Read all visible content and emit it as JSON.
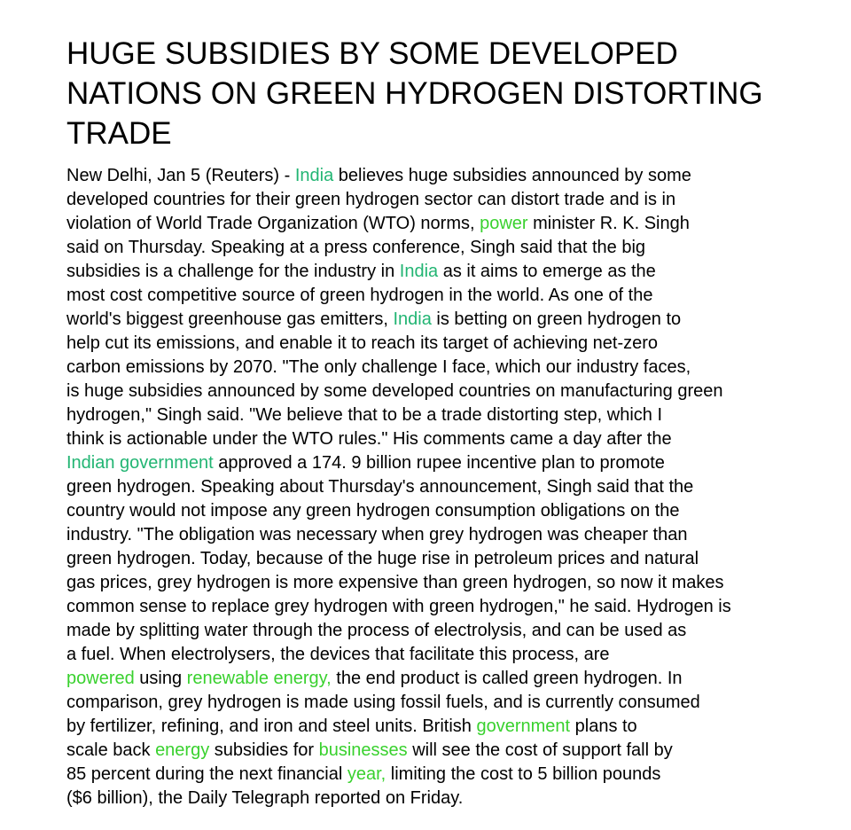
{
  "article": {
    "headline_lines": [
      "HUGE SUBSIDIES BY SOME DEVELOPED",
      "NATIONS ON GREEN HYDROGEN DISTORTING",
      "TRADE"
    ],
    "colors": {
      "text": "#000000",
      "keyword_teal": "#22b573",
      "keyword_green": "#39d12e"
    },
    "lines": [
      [
        {
          "t": "New Delhi, Jan 5 (Reuters) - "
        },
        {
          "t": "India",
          "c": "teal"
        },
        {
          "t": " believes huge subsidies announced by some"
        }
      ],
      [
        {
          "t": "developed countries for their green hydrogen sector can distort trade and is in"
        }
      ],
      [
        {
          "t": "violation of World Trade Organization (WTO) norms, "
        },
        {
          "t": "power",
          "c": "green"
        },
        {
          "t": " minister R. K. Singh"
        }
      ],
      [
        {
          "t": "said on Thursday. Speaking at a press conference, Singh said that the big"
        }
      ],
      [
        {
          "t": "subsidies is a challenge for the industry in "
        },
        {
          "t": "India",
          "c": "teal"
        },
        {
          "t": " as it aims to emerge as the"
        }
      ],
      [
        {
          "t": "most cost competitive source of green hydrogen in the world. As one of the"
        }
      ],
      [
        {
          "t": "world's biggest greenhouse gas emitters, "
        },
        {
          "t": "India",
          "c": "teal"
        },
        {
          "t": " is betting on green hydrogen to"
        }
      ],
      [
        {
          "t": "help cut its emissions, and enable it to reach its target of achieving net-zero"
        }
      ],
      [
        {
          "t": "carbon emissions by 2070. \"The only challenge I face, which our industry faces,"
        }
      ],
      [
        {
          "t": "is huge subsidies announced by some developed countries on manufacturing green"
        }
      ],
      [
        {
          "t": "hydrogen,\" Singh said. \"We believe that to be a trade distorting step, which I"
        }
      ],
      [
        {
          "t": "think is actionable under the WTO rules.\" His comments came a day after the"
        }
      ],
      [
        {
          "t": "Indian government",
          "c": "teal"
        },
        {
          "t": " approved a 174. 9 billion rupee incentive plan to promote"
        }
      ],
      [
        {
          "t": "green hydrogen. Speaking about Thursday's announcement, Singh said that the"
        }
      ],
      [
        {
          "t": "country would not impose any green hydrogen consumption obligations on the"
        }
      ],
      [
        {
          "t": "industry. \"The obligation was necessary when grey hydrogen was cheaper than"
        }
      ],
      [
        {
          "t": "green hydrogen. Today, because of the huge rise in petroleum prices and natural"
        }
      ],
      [
        {
          "t": "gas prices, grey hydrogen is more expensive than green hydrogen, so now it makes"
        }
      ],
      [
        {
          "t": "common sense to replace grey hydrogen with green hydrogen,\" he said. Hydrogen is"
        }
      ],
      [
        {
          "t": "made by splitting water through the process of electrolysis, and can be used as"
        }
      ],
      [
        {
          "t": "a fuel. When electrolysers, the devices that facilitate this process, are"
        }
      ],
      [
        {
          "t": "powered",
          "c": "green"
        },
        {
          "t": " using "
        },
        {
          "t": "renewable energy,",
          "c": "green"
        },
        {
          "t": " the end product is called green hydrogen. In"
        }
      ],
      [
        {
          "t": "comparison, grey hydrogen is made using fossil fuels, and is currently consumed"
        }
      ],
      [
        {
          "t": "by fertilizer, refining, and iron and steel units. British "
        },
        {
          "t": "government",
          "c": "green"
        },
        {
          "t": " plans to"
        }
      ],
      [
        {
          "t": "scale back "
        },
        {
          "t": "energy",
          "c": "green"
        },
        {
          "t": " subsidies for "
        },
        {
          "t": "businesses",
          "c": "green"
        },
        {
          "t": " will see the cost of support fall by"
        }
      ],
      [
        {
          "t": "85 percent during the next financial "
        },
        {
          "t": "year,",
          "c": "green"
        },
        {
          "t": " limiting the cost to 5 billion pounds"
        }
      ],
      [
        {
          "t": "($6 billion), the Daily Telegraph reported on Friday."
        }
      ]
    ]
  }
}
